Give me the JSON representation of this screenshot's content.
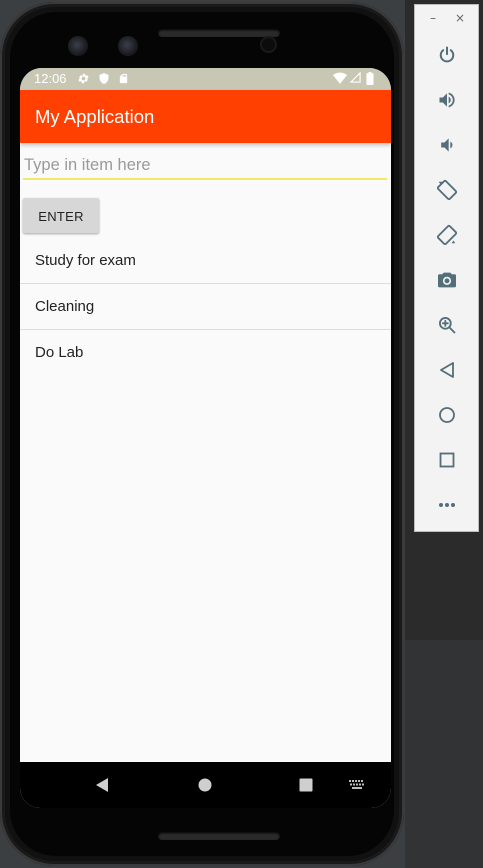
{
  "status_bar": {
    "time": "12:06"
  },
  "app": {
    "title": "My Application",
    "input_placeholder": "Type in item here",
    "input_value": "",
    "enter_label": "ENTER",
    "items": [
      {
        "label": "Study for exam"
      },
      {
        "label": "Cleaning"
      },
      {
        "label": "Do Lab"
      }
    ]
  },
  "emulator_panel": {
    "minimize_glyph": "–",
    "close_glyph": "×",
    "tools": [
      "power-icon",
      "volume-up-icon",
      "volume-down-icon",
      "rotate-left-icon",
      "rotate-right-icon",
      "camera-icon",
      "zoom-icon",
      "back-icon",
      "home-icon",
      "overview-icon",
      "more-icon"
    ]
  },
  "colors": {
    "app_bar": "#ff4000",
    "status_bar": "#c8c7b4",
    "input_underline": "#f2e96a",
    "panel_icon": "#546e7a"
  }
}
